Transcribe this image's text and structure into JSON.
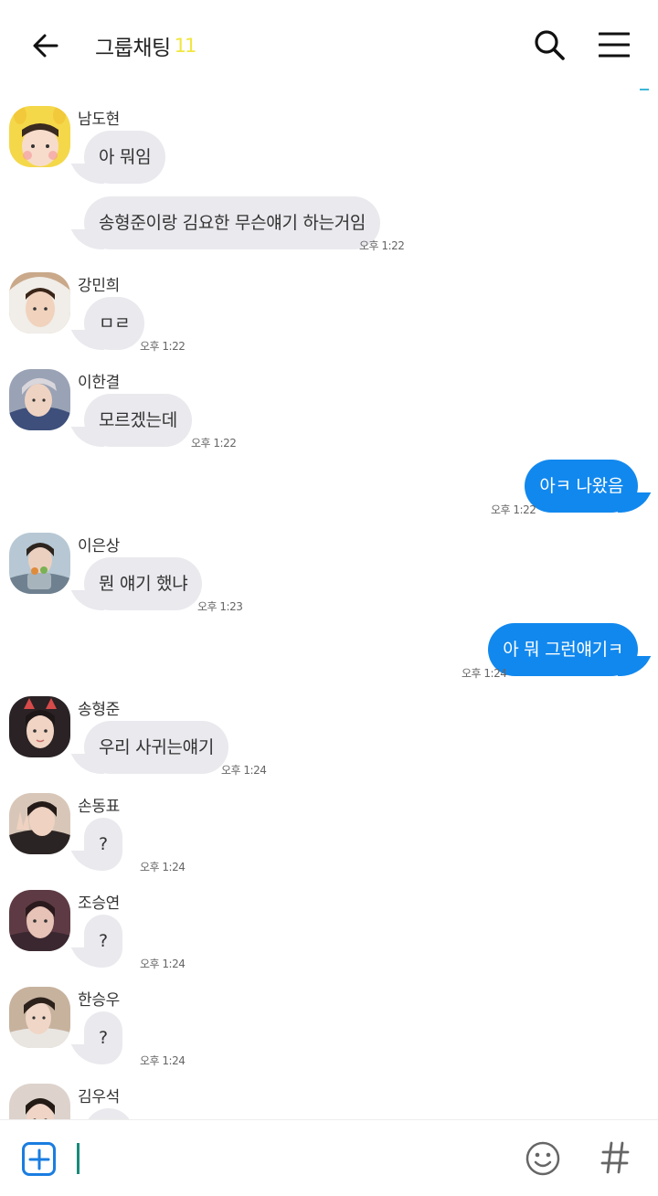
{
  "header": {
    "title": "그룹채팅",
    "member_count": "11"
  },
  "messages": [
    {
      "sender": "남도현",
      "avatar": "avatar-yellow-chick-hat",
      "bubbles": [
        "아 뭐임",
        "송형준이랑 김요한 무슨얘기 하는거임"
      ],
      "time": "오후 1:22"
    },
    {
      "sender": "강민희",
      "avatar": "avatar-white-hood",
      "bubbles": [
        "ㅁㄹ"
      ],
      "time": "오후 1:22"
    },
    {
      "sender": "이한결",
      "avatar": "avatar-silver-hair",
      "bubbles": [
        "모르겠는데"
      ],
      "time": "오후 1:22"
    },
    {
      "mine": true,
      "bubbles": [
        "아ㅋ 나왔음"
      ],
      "time": "오후 1:22"
    },
    {
      "sender": "이은상",
      "avatar": "avatar-holding-plant",
      "bubbles": [
        "뭔 얘기 했냐"
      ],
      "time": "오후 1:23"
    },
    {
      "mine": true,
      "bubbles": [
        "아 뭐 그런얘기ㅋ"
      ],
      "time": "오후 1:24"
    },
    {
      "sender": "송형준",
      "avatar": "avatar-red-horns",
      "bubbles": [
        "우리 사귀는얘기"
      ],
      "time": "오후 1:24"
    },
    {
      "sender": "손동표",
      "avatar": "avatar-peace-sign",
      "bubbles": [
        "?"
      ],
      "time": "오후 1:24"
    },
    {
      "sender": "조승연",
      "avatar": "avatar-dark-portrait",
      "bubbles": [
        "?"
      ],
      "time": "오후 1:24"
    },
    {
      "sender": "한승우",
      "avatar": "avatar-side-profile",
      "bubbles": [
        "?"
      ],
      "time": "오후 1:24"
    },
    {
      "sender": "김우석",
      "avatar": "avatar-dark-hair",
      "bubbles": [],
      "time": ""
    }
  ],
  "input": {
    "value": "",
    "placeholder": ""
  },
  "colors": {
    "my_bubble": "#1188ee",
    "other_bubble": "#e9e9ee",
    "member_count": "#f0e640",
    "plus_button": "#1a7de0",
    "caret": "#1a8a7a"
  },
  "icons": {
    "back": "arrow-left-icon",
    "search": "search-icon",
    "menu": "hamburger-menu-icon",
    "attach": "plus-square-icon",
    "emoji": "smiley-icon",
    "hashtag": "hashtag-icon"
  }
}
